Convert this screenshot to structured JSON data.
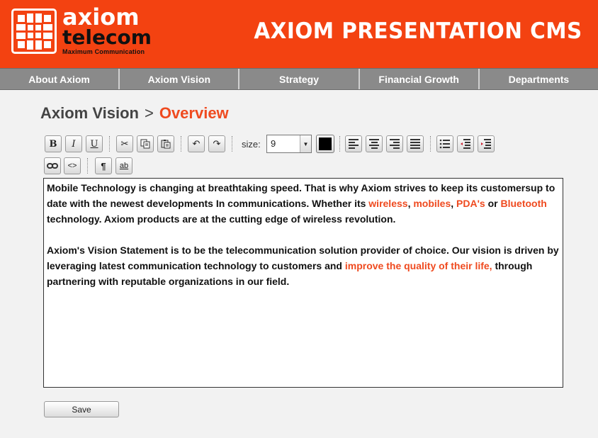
{
  "header": {
    "logo_word1": "axiom",
    "logo_word2": "telecom",
    "logo_tagline": "Maximum Communication",
    "app_title": "AXIOM PRESENTATION CMS",
    "brand_color": "#f34211"
  },
  "nav": {
    "items": [
      {
        "label": "About Axiom"
      },
      {
        "label": "Axiom Vision"
      },
      {
        "label": "Strategy"
      },
      {
        "label": "Financial Growth"
      },
      {
        "label": "Departments"
      }
    ]
  },
  "breadcrumb": {
    "parent": "Axiom Vision",
    "separator": ">",
    "current": "Overview"
  },
  "toolbar": {
    "bold": "B",
    "italic": "I",
    "underline": "U",
    "cut_icon": "✂",
    "undo_icon": "↶",
    "redo_icon": "↷",
    "size_label": "size:",
    "size_value": "9",
    "pilcrow": "¶",
    "spell_icon": "ab",
    "source_icon": "<>",
    "link_icon": "∞",
    "text_color": "#000000"
  },
  "editor": {
    "p1": {
      "a": "Mobile Technology is changing at breathtaking speed. That is why Axiom strives to keep its customersup to date with the newest developments In communications. Whether its ",
      "w1": "wireless",
      "c1": ", ",
      "w2": "mobiles",
      "c2": ", ",
      "w3": "PDA's",
      "c3": " or ",
      "w4": "Bluetooth",
      "b": " technology. Axiom products are at the cutting edge of wireless revolution."
    },
    "p2": {
      "a": "Axiom's Vision Statement is to be the telecommunication solution provider of choice. Our vision is driven by leveraging latest communication technology to customers and ",
      "w1": "improve the quality of their life,",
      "b": " through partnering with reputable organizations in our field."
    },
    "highlight_color": "#ef4a1f"
  },
  "save": {
    "label": "Save"
  }
}
